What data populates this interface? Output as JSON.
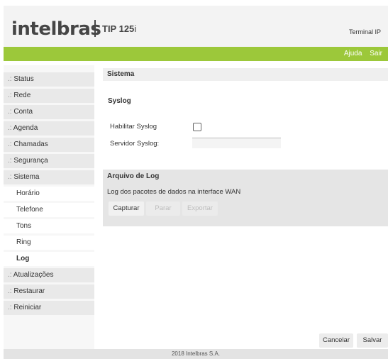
{
  "header": {
    "logo": "intelbras",
    "model_prefix": "TIP 125",
    "model_suffix": "i",
    "terminal": "Terminal IP"
  },
  "topbar": {
    "help": "Ajuda",
    "exit": "Sair"
  },
  "sidebar": {
    "items": [
      {
        "label": "Status"
      },
      {
        "label": "Rede"
      },
      {
        "label": "Conta"
      },
      {
        "label": "Agenda"
      },
      {
        "label": "Chamadas"
      },
      {
        "label": "Segurança"
      },
      {
        "label": "Sistema"
      }
    ],
    "subitems": [
      {
        "label": "Horário"
      },
      {
        "label": "Telefone"
      },
      {
        "label": "Tons"
      },
      {
        "label": "Ring"
      },
      {
        "label": "Log"
      }
    ],
    "bottom_items": [
      {
        "label": "Atualizações"
      },
      {
        "label": "Restaurar"
      },
      {
        "label": "Reiniciar"
      }
    ],
    "prefix": ".:"
  },
  "content": {
    "title": "Sistema",
    "syslog": {
      "title": "Syslog",
      "enable_label": "Habilitar Syslog",
      "enable_checked": false,
      "server_label": "Servidor Syslog:",
      "server_value": ""
    },
    "log": {
      "title": "Arquivo de Log",
      "description": "Log dos pacotes de dados na interface WAN",
      "capture_label": "Capturar",
      "stop_label": "Parar",
      "export_label": "Exportar"
    },
    "cancel_label": "Cancelar",
    "save_label": "Salvar"
  },
  "footer": {
    "copyright": "2018 Intelbras S.A."
  }
}
